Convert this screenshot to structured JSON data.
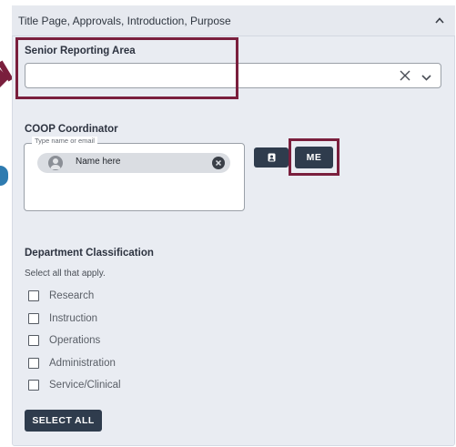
{
  "panel": {
    "title": "Title Page, Approvals, Introduction, Purpose"
  },
  "senior_reporting_area": {
    "label": "Senior Reporting Area",
    "value": ""
  },
  "coop_coordinator": {
    "label": "COOP Coordinator",
    "placeholder": "Type name or email",
    "chip_text": "Name here",
    "me_button": "ME"
  },
  "department_classification": {
    "label": "Department Classification",
    "hint": "Select all that apply.",
    "options": [
      "Research",
      "Instruction",
      "Operations",
      "Administration",
      "Service/Clinical"
    ],
    "select_all_button": "SELECT ALL"
  },
  "colors": {
    "highlight": "#7a1f3d",
    "button_dark": "#2f3c4d",
    "panel_bg": "#e9ecf2"
  }
}
